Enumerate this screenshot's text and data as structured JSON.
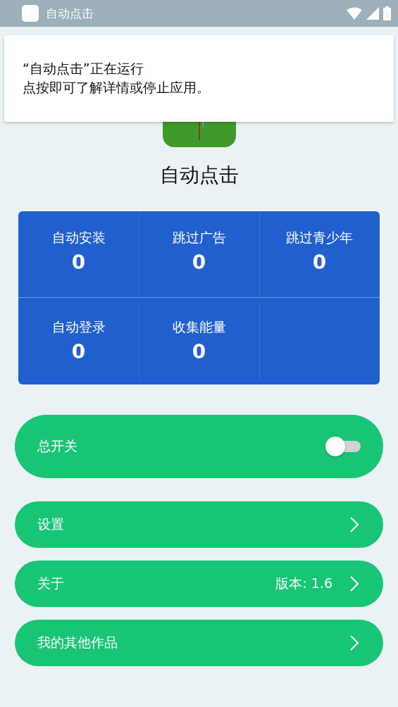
{
  "status_bar": {
    "title": "自动点击"
  },
  "notification": {
    "title": "“自动点击”正在运行",
    "body": "点按即可了解详情或停止应用。"
  },
  "app": {
    "name": "自动点击"
  },
  "stats": [
    {
      "label": "自动安装",
      "value": "0"
    },
    {
      "label": "跳过广告",
      "value": "0"
    },
    {
      "label": "跳过青少年",
      "value": "0"
    },
    {
      "label": "自动登录",
      "value": "0"
    },
    {
      "label": "收集能量",
      "value": "0"
    }
  ],
  "master_switch": {
    "label": "总开关",
    "on": false
  },
  "menu": [
    {
      "label": "设置"
    },
    {
      "label": "关于",
      "detail": "版本: 1.6"
    },
    {
      "label": "我的其他作品"
    }
  ]
}
